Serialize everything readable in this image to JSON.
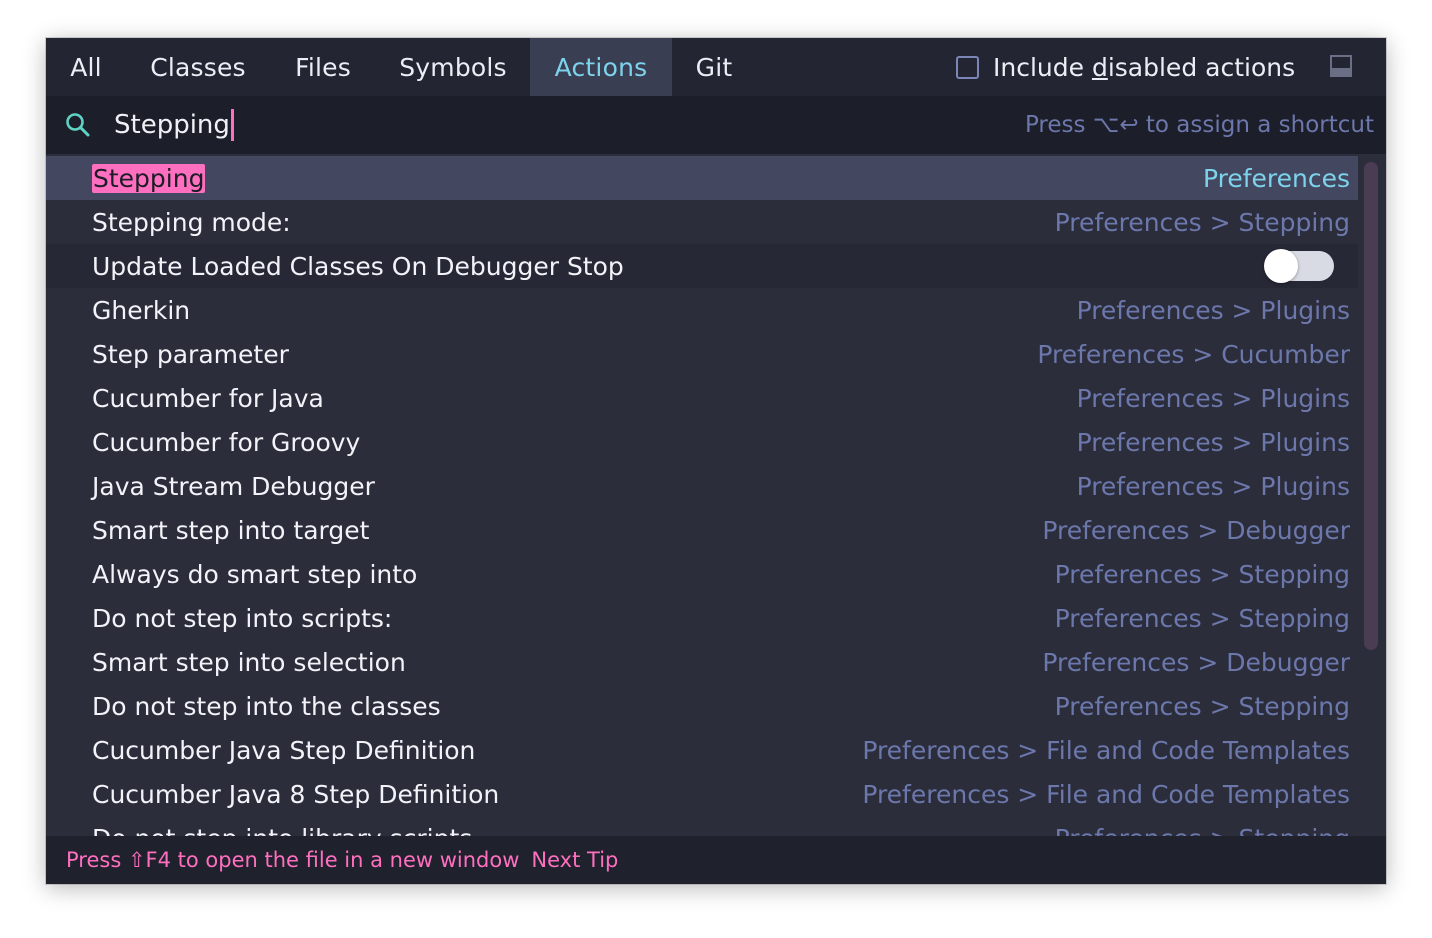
{
  "tabs": [
    {
      "label": "All",
      "active": false
    },
    {
      "label": "Classes",
      "active": false
    },
    {
      "label": "Files",
      "active": false
    },
    {
      "label": "Symbols",
      "active": false
    },
    {
      "label": "Actions",
      "active": true
    },
    {
      "label": "Git",
      "active": false
    }
  ],
  "include_disabled": {
    "label_before": "Include ",
    "label_mnemonic": "d",
    "label_after": "isabled actions",
    "checked": false
  },
  "search": {
    "value": "Stepping",
    "hint": "Press ⌥↩ to assign a shortcut"
  },
  "results": [
    {
      "name": "Stepping",
      "path": "Preferences",
      "selected": true
    },
    {
      "name": "Stepping mode:",
      "path": "Preferences > Stepping"
    },
    {
      "name": "Update Loaded Classes On Debugger Stop",
      "path": "",
      "toggle": true
    },
    {
      "name": "Gherkin",
      "path": "Preferences > Plugins"
    },
    {
      "name": "Step parameter",
      "path": "Preferences > Cucumber"
    },
    {
      "name": "Cucumber for Java",
      "path": "Preferences > Plugins"
    },
    {
      "name": "Cucumber for Groovy",
      "path": "Preferences > Plugins"
    },
    {
      "name": "Java Stream Debugger",
      "path": "Preferences > Plugins"
    },
    {
      "name": "Smart step into target",
      "path": "Preferences > Debugger"
    },
    {
      "name": "Always do smart step into",
      "path": "Preferences > Stepping"
    },
    {
      "name": "Do not step into scripts:",
      "path": "Preferences > Stepping"
    },
    {
      "name": "Smart step into selection",
      "path": "Preferences > Debugger"
    },
    {
      "name": "Do not step into the classes",
      "path": "Preferences > Stepping"
    },
    {
      "name": "Cucumber Java Step Definition",
      "path": "Preferences > File and Code Templates"
    },
    {
      "name": "Cucumber Java 8 Step Definition",
      "path": "Preferences > File and Code Templates"
    },
    {
      "name": "Do not step into library scripts",
      "path": "Preferences > Stepping"
    }
  ],
  "footer": {
    "text": "Press ⇧F4 to open the file in a new window",
    "next_tip": "Next Tip"
  },
  "colors": {
    "accent_cyan": "#7dd3ec",
    "highlight_pink": "#ff6fbf",
    "path_blue": "#6c77ab",
    "background": "#2b2d3b"
  }
}
